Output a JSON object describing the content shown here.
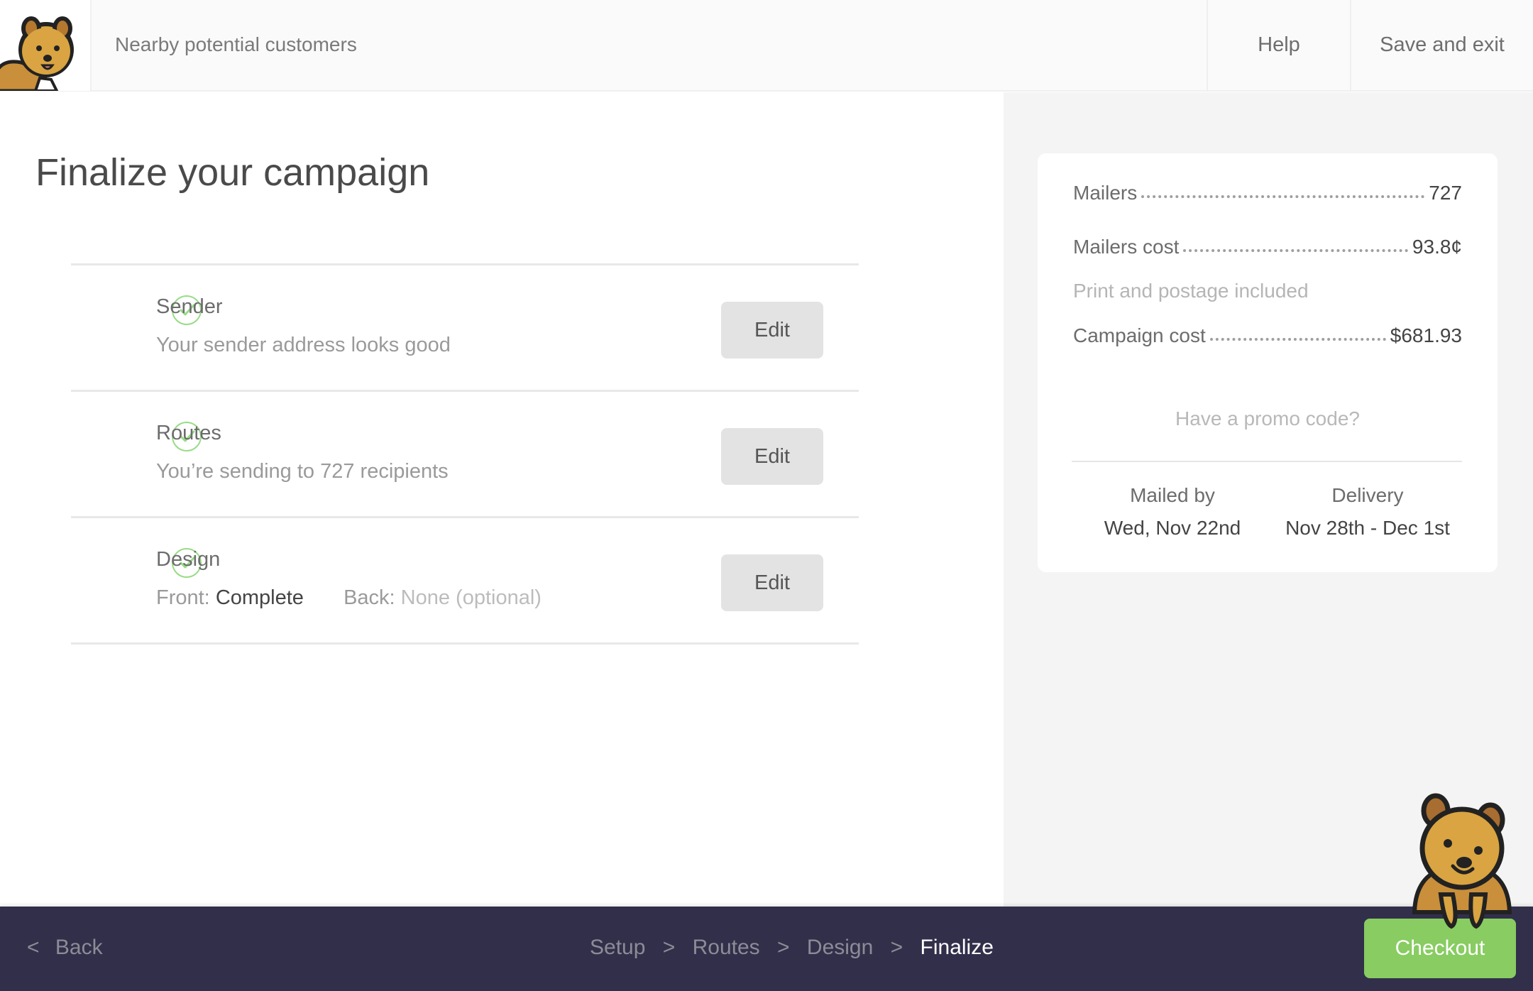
{
  "header": {
    "title": "Nearby potential customers",
    "help_label": "Help",
    "save_exit_label": "Save and exit"
  },
  "main": {
    "page_title": "Finalize your campaign",
    "steps": [
      {
        "title": "Sender",
        "description": "Your sender address looks good",
        "status": "complete",
        "edit_label": "Edit"
      },
      {
        "title": "Routes",
        "description": "You’re sending to 727 recipients",
        "status": "complete",
        "edit_label": "Edit"
      },
      {
        "title": "Design",
        "front_label": "Front:",
        "front_value": "Complete",
        "back_label": "Back:",
        "back_value": "None (optional)",
        "status": "complete",
        "edit_label": "Edit"
      }
    ]
  },
  "summary": {
    "mailers_label": "Mailers",
    "mailers_value": "727",
    "mailers_cost_label": "Mailers cost",
    "mailers_cost_value": "93.8¢",
    "note": "Print and postage included",
    "campaign_cost_label": "Campaign cost",
    "campaign_cost_value": "$681.93",
    "promo_link": "Have a promo code?",
    "mailed_by_label": "Mailed by",
    "mailed_by_value": "Wed, Nov 22nd",
    "delivery_label": "Delivery",
    "delivery_value": "Nov 28th - Dec 1st"
  },
  "footer": {
    "back_label": "Back",
    "breadcrumbs": [
      "Setup",
      "Routes",
      "Design",
      "Finalize"
    ],
    "breadcrumb_separator": ">",
    "active_step": "Finalize",
    "checkout_label": "Checkout"
  },
  "colors": {
    "accent_green": "#88cc62",
    "check_green": "#97dc85",
    "footer_bg": "#322f4b",
    "mascot_fur": "#d9a441"
  },
  "icons": {
    "logo": "quokka-mascot-icon",
    "step_status": "check-circle-icon",
    "back": "chevron-left-icon"
  }
}
